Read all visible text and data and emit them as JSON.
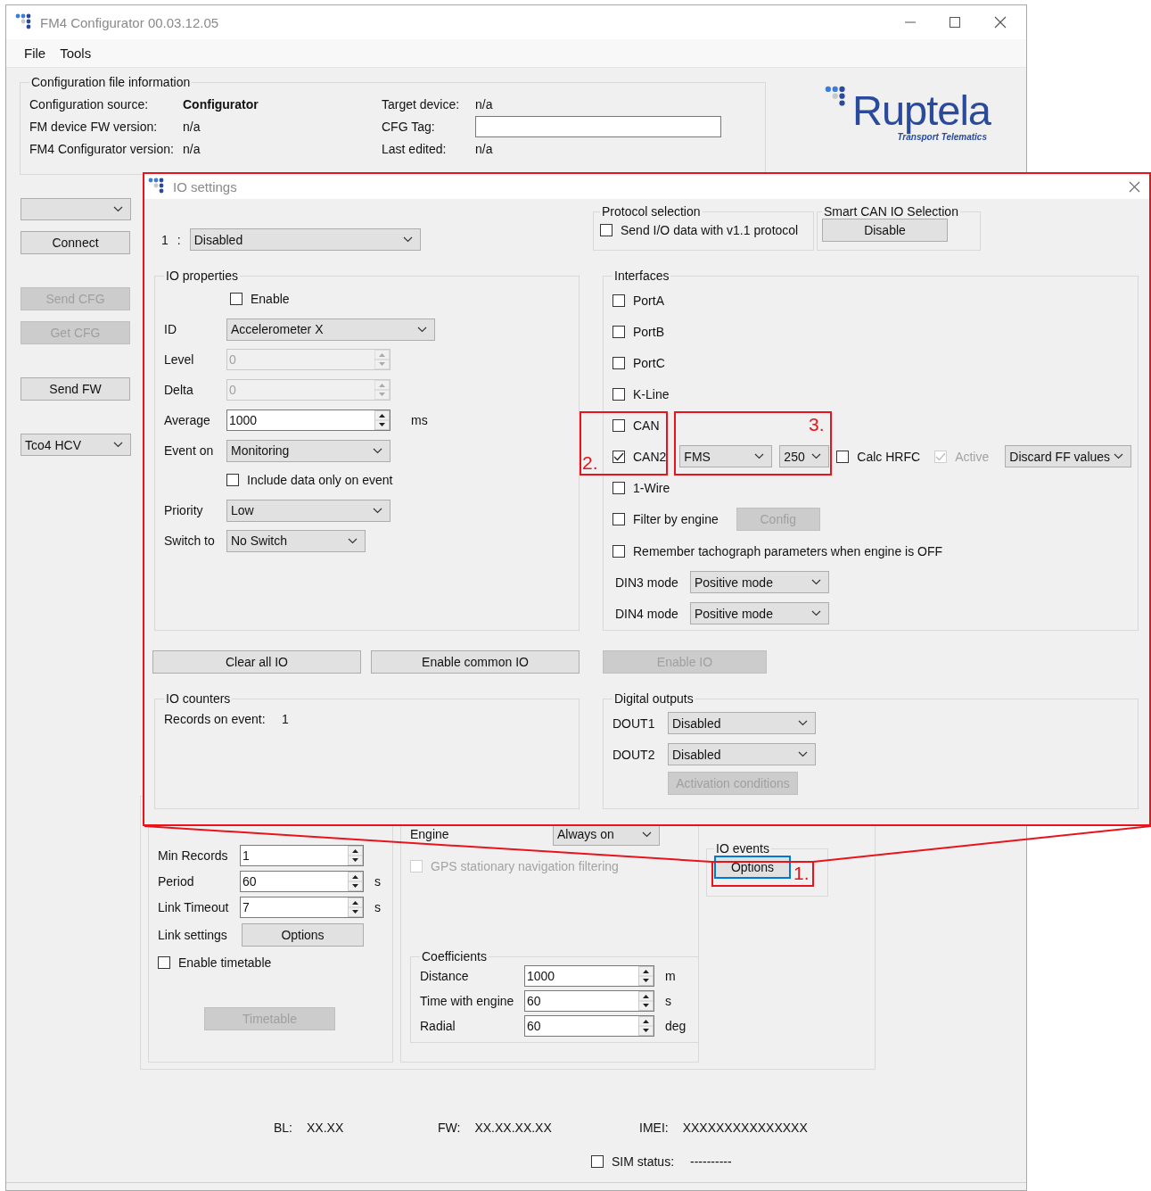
{
  "window": {
    "title": "FM4 Configurator 00.03.12.05"
  },
  "menu": [
    "File",
    "Tools"
  ],
  "config_info": {
    "title": "Configuration file information",
    "left_fields": [
      {
        "label": "Configuration source:",
        "value": "Configurator",
        "bold": true
      },
      {
        "label": "FM device FW version:",
        "value": "n/a",
        "bold": false
      },
      {
        "label": "FM4 Configurator version:",
        "value": "n/a",
        "bold": false
      }
    ],
    "right_fields": [
      {
        "kind": "text",
        "label": "Target device:",
        "value": "n/a"
      },
      {
        "kind": "input",
        "label": "CFG Tag:"
      },
      {
        "kind": "text",
        "label": "Last edited:",
        "value": "n/a"
      }
    ]
  },
  "logo": {
    "name": "Ruptela",
    "tagline": "Transport Telematics"
  },
  "sidebar": {
    "groups": [
      [
        {
          "kind": "dropdown"
        },
        {
          "kind": "button",
          "label": "Connect",
          "disabled": false
        }
      ],
      [
        {
          "kind": "button",
          "label": "Send CFG",
          "disabled": true
        },
        {
          "kind": "button",
          "label": "Get CFG",
          "disabled": true
        }
      ],
      [
        {
          "kind": "button",
          "label": "Send FW",
          "disabled": false
        }
      ],
      [
        {
          "kind": "dropdown",
          "value": "Tco4 HCV"
        }
      ]
    ]
  },
  "general": {
    "fields": [
      {
        "label": "Min Records",
        "value": "1"
      },
      {
        "label": "Period",
        "value": "60",
        "unit": "s"
      },
      {
        "label": "Link Timeout",
        "value": "7",
        "unit": "s"
      }
    ],
    "link_settings": {
      "label": "Link settings",
      "button": "Options"
    },
    "timetable_checkbox": {
      "label": "Enable timetable",
      "checked": false
    },
    "timetable_button": {
      "label": "Timetable",
      "disabled": true
    }
  },
  "engine": {
    "label": "Engine",
    "value": "Always on",
    "gps_filter": {
      "label": "GPS stationary navigation filtering",
      "checked": false,
      "disabled": true
    },
    "coefficients": {
      "title": "Coefficients",
      "fields": [
        {
          "label": "Distance",
          "value": "1000",
          "unit": "m"
        },
        {
          "label": "Time with engine",
          "value": "60",
          "unit": "s"
        },
        {
          "label": "Radial",
          "value": "60",
          "unit": "deg"
        }
      ]
    }
  },
  "io_events": {
    "title": "IO events",
    "button": "Options",
    "focused": true
  },
  "status": [
    {
      "label": "BL:",
      "value": "XX.XX"
    },
    {
      "label": "FW:",
      "value": "XX.XX.XX.XX"
    },
    {
      "label": "IMEI:",
      "value": "XXXXXXXXXXXXXXX"
    }
  ],
  "sim": {
    "label": "SIM status:",
    "value": "----------",
    "checked": false
  },
  "dialog": {
    "title": "IO settings",
    "io_number": "1",
    "separator": ":",
    "io_select": "Disabled",
    "protocol": {
      "title": "Protocol selection",
      "checkbox": {
        "label": "Send I/O data with v1.1 protocol",
        "checked": false
      }
    },
    "smart_can": {
      "title": "Smart CAN IO Selection",
      "button": "Disable"
    },
    "io_properties": {
      "title": "IO properties",
      "rows": [
        {
          "kind": "checkbox",
          "label": "Enable",
          "checked": false
        },
        {
          "kind": "select",
          "label": "ID",
          "value": "Accelerometer X"
        },
        {
          "kind": "spin",
          "label": "Level",
          "value": "0",
          "disabled": true
        },
        {
          "kind": "spin",
          "label": "Delta",
          "value": "0",
          "disabled": true
        },
        {
          "kind": "spin",
          "label": "Average",
          "value": "1000",
          "disabled": false,
          "unit": "ms"
        },
        {
          "kind": "select",
          "label": "Event on",
          "value": "Monitoring"
        },
        {
          "kind": "checkbox",
          "label": "Include data only on event",
          "checked": false
        },
        {
          "kind": "select",
          "label": "Priority",
          "value": "Low"
        },
        {
          "kind": "select",
          "label": "Switch to",
          "value": "No Switch"
        }
      ]
    },
    "interfaces": {
      "title": "Interfaces",
      "items": [
        {
          "kind": "checkbox",
          "label": "PortA",
          "checked": false
        },
        {
          "kind": "checkbox",
          "label": "PortB",
          "checked": false
        },
        {
          "kind": "checkbox",
          "label": "PortC",
          "checked": false
        },
        {
          "kind": "checkbox",
          "label": "K-Line",
          "checked": false
        },
        {
          "kind": "checkbox",
          "label": "CAN",
          "checked": false
        },
        {
          "kind": "can",
          "label": "CAN2",
          "checked": true,
          "protocol": "FMS",
          "speed": "250",
          "calc_hrfc": {
            "label": "Calc HRFC",
            "checked": false
          },
          "active": {
            "label": "Active",
            "checked": true,
            "disabled": true
          },
          "ff_mode": "Discard FF values"
        },
        {
          "kind": "checkbox",
          "label": "1-Wire",
          "checked": false
        },
        {
          "kind": "filter",
          "label": "Filter by engine",
          "checked": false,
          "button": {
            "label": "Config",
            "disabled": true
          }
        },
        {
          "kind": "checkbox",
          "label": "Remember tachograph parameters when engine is OFF",
          "checked": false
        },
        {
          "kind": "select",
          "label": "DIN3 mode",
          "value": "Positive mode"
        },
        {
          "kind": "select",
          "label": "DIN4 mode",
          "value": "Positive mode"
        }
      ]
    },
    "actions": [
      {
        "label": "Clear all IO",
        "disabled": false
      },
      {
        "label": "Enable common IO",
        "disabled": false
      },
      {
        "label": "Enable IO",
        "disabled": true
      }
    ],
    "io_counters": {
      "title": "IO counters",
      "label": "Records on event:",
      "value": "1"
    },
    "digital_outputs": {
      "title": "Digital outputs",
      "outputs": [
        {
          "label": "DOUT1",
          "value": "Disabled"
        },
        {
          "label": "DOUT2",
          "value": "Disabled"
        }
      ],
      "button": {
        "label": "Activation conditions",
        "disabled": true
      }
    }
  },
  "annotations": [
    {
      "label": "1."
    },
    {
      "label": "2."
    },
    {
      "label": "3."
    }
  ]
}
